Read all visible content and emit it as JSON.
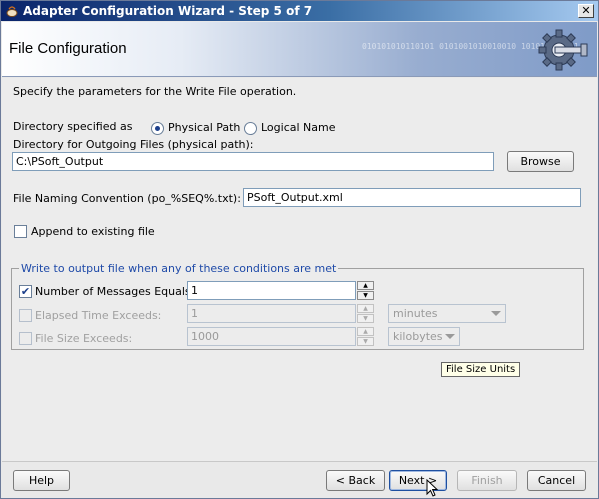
{
  "window": {
    "title": "Adapter Configuration Wizard - Step 5 of 7",
    "close_glyph": "✕"
  },
  "banner": {
    "heading": "File Configuration",
    "binary_deco": "010101010110101\n0101001010010010\n101011010101"
  },
  "intro_text": "Specify the parameters for the Write File operation.",
  "directory": {
    "specified_as_label": "Directory specified as",
    "physical_path_label": "Physical Path",
    "logical_name_label": "Logical Name",
    "selected": "Physical Path",
    "outgoing_label": "Directory for Outgoing Files (physical path):",
    "outgoing_value": "C:\\PSoft_Output",
    "browse_label": "Browse"
  },
  "naming": {
    "label": "File Naming Convention (po_%SEQ%.txt):",
    "value": "PSoft_Output.xml"
  },
  "append": {
    "label": "Append to existing file",
    "checked": false
  },
  "conditions": {
    "legend": "Write to output file when any of these conditions are met",
    "messages": {
      "label": "Number of Messages Equals:",
      "value": "1",
      "checked": true,
      "check_glyph": "✔"
    },
    "elapsed": {
      "label": "Elapsed Time Exceeds:",
      "value": "1",
      "unit": "minutes",
      "checked": false
    },
    "filesize": {
      "label": "File Size Exceeds:",
      "value": "1000",
      "unit": "kilobytes",
      "checked": false
    }
  },
  "tooltip": "File Size Units",
  "footer": {
    "help": "Help",
    "back": "< Back",
    "next": "Next >",
    "finish": "Finish",
    "cancel": "Cancel"
  },
  "icons": {
    "spinner_up": "▲",
    "spinner_down": "▼"
  }
}
